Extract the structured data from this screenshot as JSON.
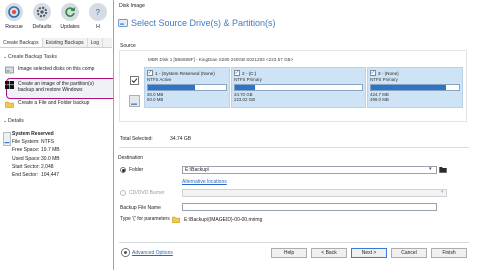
{
  "toolbar": {
    "items": [
      {
        "label": "Rescue",
        "icon": "rescue-icon"
      },
      {
        "label": "Defaults",
        "icon": "gear-icon"
      },
      {
        "label": "Updates",
        "icon": "refresh-icon"
      },
      {
        "label": "H",
        "icon": "help-icon"
      }
    ]
  },
  "tabs": [
    "Create Backups",
    "Existing Backups",
    "Log"
  ],
  "backup_tasks": {
    "header": "Create Backup Tasks",
    "items": [
      "Image selected disks on this comp",
      "Create an image of the partition(s)",
      "backup and restore Windows",
      "Create a File and Folder backup"
    ]
  },
  "details": {
    "header": "Details",
    "title": "System Reserved",
    "rows": [
      {
        "k": "File System:",
        "v": "NTFS"
      },
      {
        "k": "Free Space:",
        "v": "19.7 MB"
      },
      {
        "k": "Used Space:",
        "v": "30.0 MB"
      },
      {
        "k": "Start Sector:",
        "v": "2,048"
      },
      {
        "k": "End Sector:",
        "v": "104,447"
      }
    ]
  },
  "dialog": {
    "window_title": "Disk Image",
    "heading": "Select Source Drive(s) & Partition(s)",
    "source_label": "Source",
    "disk_name": "MBR Disk 1 [5B6688F] - KingDian S280 240GB S021283  <223.57 GB>",
    "partitions": [
      {
        "name": "1 - (System Reserved (None)",
        "fs": "NTFS Active",
        "used": "30.0 MB",
        "total": "50.0 MB",
        "fill_pct": 60
      },
      {
        "name": "2 - (C:)",
        "fs": "NTFS Primary",
        "used": "34.70 GB",
        "total": "223.02 GB",
        "fill_pct": 16
      },
      {
        "name": "3 - (None)",
        "fs": "NTFS Primary",
        "used": "424.7 MB",
        "total": "499.0 MB",
        "fill_pct": 85
      }
    ],
    "total_selected_label": "Total Selected:",
    "total_selected_value": "34.74 GB",
    "destination_label": "Destination",
    "folder_label": "Folder",
    "folder_value": "E:\\Backup\\",
    "alt_locations": "Alternative locations",
    "cd_dvd_label": "CD/DVD Burner",
    "backup_file_label": "Backup File Name",
    "param_hint": "Type '{' for parameters",
    "file_path_preview": "E:\\Backup\\{IMAGEID}-00-00.mrimg",
    "advanced_options": "Advanced Options",
    "buttons": {
      "help": "Help",
      "back": "< Back",
      "next": "Next >",
      "cancel": "Cancel",
      "finish": "Finish"
    }
  },
  "colors": {
    "accent": "#3b7dc4",
    "partition_bg": "#cfe3f6",
    "bar_fill": "#2f74c6",
    "highlight_border": "#b0107e"
  }
}
